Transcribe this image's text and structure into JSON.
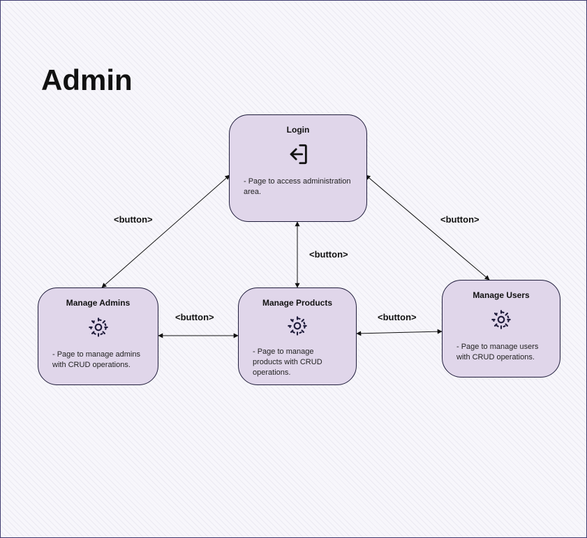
{
  "title": "Admin",
  "nodes": {
    "login": {
      "title": "Login",
      "desc": " - Page to access administration area."
    },
    "admins": {
      "title": "Manage Admins",
      "desc": " - Page to manage admins with CRUD operations."
    },
    "products": {
      "title": "Manage Products",
      "desc": " - Page to manage products with CRUD operations."
    },
    "users": {
      "title": "Manage Users",
      "desc": " - Page to manage users with CRUD operations."
    }
  },
  "edges": {
    "e1": {
      "label": "<button>"
    },
    "e2": {
      "label": "<button>"
    },
    "e3": {
      "label": "<button>"
    },
    "e4": {
      "label": "<button>"
    },
    "e5": {
      "label": "<button>"
    }
  },
  "colors": {
    "nodeFill": "#e0d6ea",
    "nodeBorder": "#1f1c3b",
    "canvasBg": "#f7f6fb"
  }
}
